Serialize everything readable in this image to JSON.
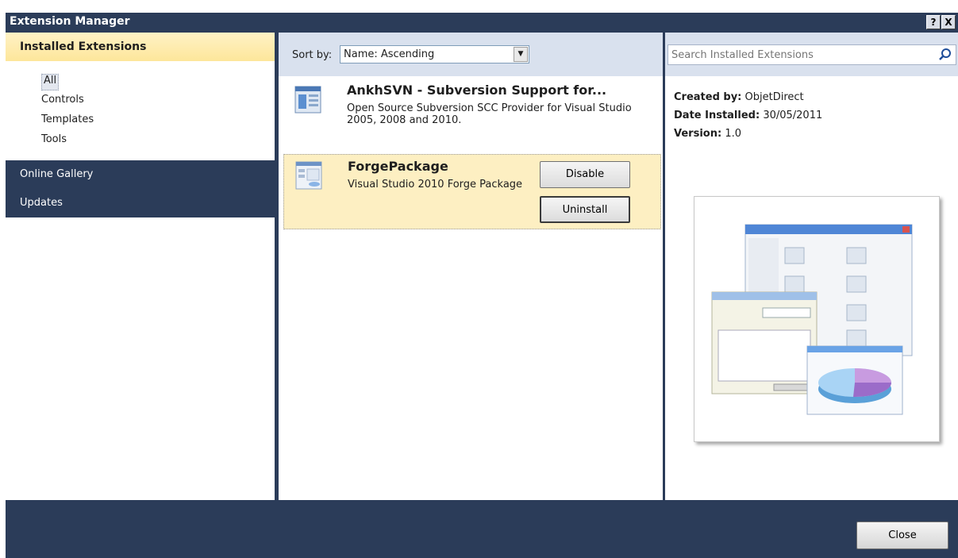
{
  "window": {
    "title": "Extension Manager",
    "help_label": "?",
    "close_label": "X"
  },
  "sidebar": {
    "header": "Installed Extensions",
    "categories": [
      "All",
      "Controls",
      "Templates",
      "Tools"
    ],
    "nav": [
      "Online Gallery",
      "Updates"
    ]
  },
  "toolbar": {
    "sort_label": "Sort by:",
    "sort_value": "Name: Ascending"
  },
  "search": {
    "placeholder": "Search Installed Extensions"
  },
  "extensions": [
    {
      "name": "AnkhSVN - Subversion Support for...",
      "description": "Open Source Subversion SCC Provider for Visual Studio 2005, 2008 and 2010."
    },
    {
      "name": "ForgePackage",
      "description": "Visual Studio 2010 Forge Package",
      "disable_label": "Disable",
      "uninstall_label": "Uninstall"
    }
  ],
  "details": {
    "created_by_label": "Created by:",
    "created_by": "ObjetDirect",
    "date_installed_label": "Date Installed:",
    "date_installed": "30/05/2011",
    "version_label": "Version:",
    "version": "1.0"
  },
  "footer": {
    "close_label": "Close"
  },
  "colors": {
    "dark_navy": "#2b3c59",
    "header_yellow": "#fde69a",
    "selection_yellow": "#fdefc2",
    "toolbar_blue": "#d9e1ee"
  }
}
